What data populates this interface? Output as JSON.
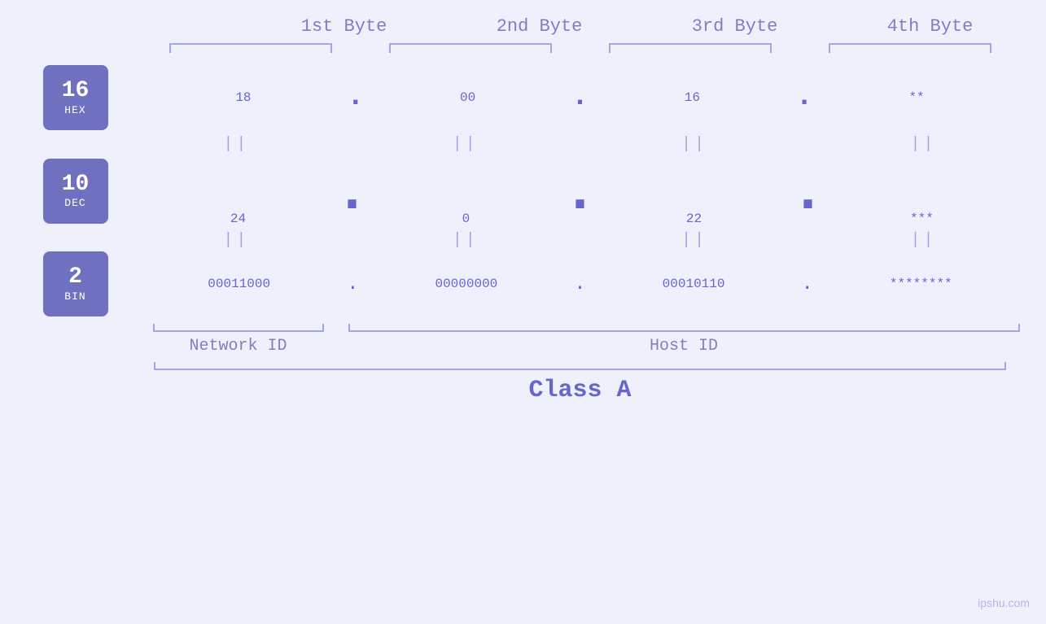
{
  "header": {
    "byte1": "1st Byte",
    "byte2": "2nd Byte",
    "byte3": "3rd Byte",
    "byte4": "4th Byte"
  },
  "bases": {
    "hex": {
      "num": "16",
      "label": "HEX"
    },
    "dec": {
      "num": "10",
      "label": "DEC"
    },
    "bin": {
      "num": "2",
      "label": "BIN"
    }
  },
  "values": {
    "hex": [
      "18",
      "00",
      "16",
      "**"
    ],
    "dec": [
      "24",
      "0",
      "22",
      "***"
    ],
    "bin": [
      "00011000",
      "00000000",
      "00010110",
      "********"
    ]
  },
  "separators": {
    "hex_dots": [
      ".",
      ".",
      ".",
      ""
    ],
    "dec_dots": [
      ".",
      ".",
      ".",
      ""
    ],
    "bin_dots": [
      ".",
      ".",
      ".",
      ""
    ]
  },
  "labels": {
    "network_id": "Network ID",
    "host_id": "Host ID",
    "class": "Class A",
    "watermark": "ipshu.com"
  }
}
